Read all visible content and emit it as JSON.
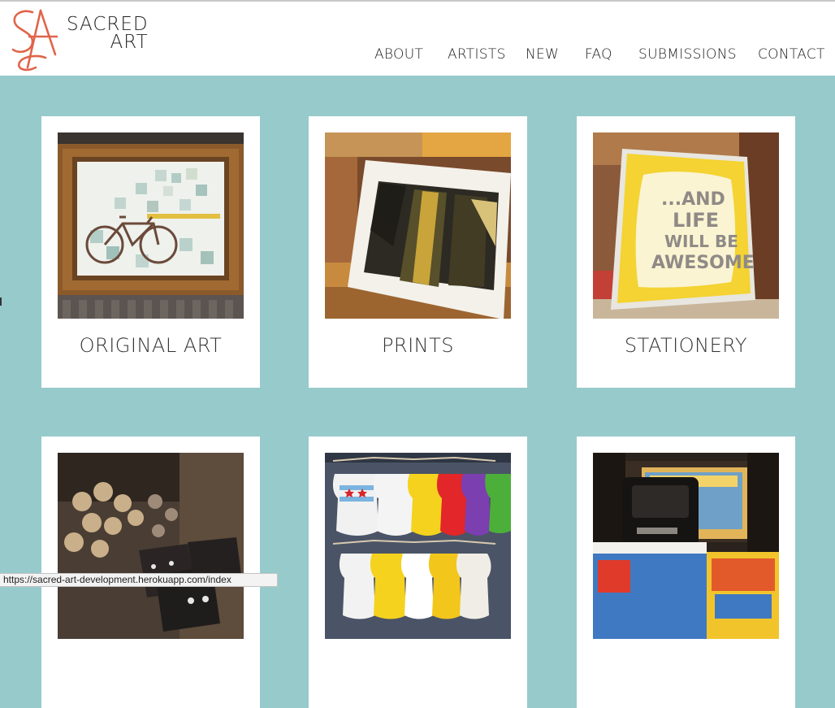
{
  "brand": {
    "monogram": "SA",
    "line1": "SACRED",
    "line2": "ART",
    "accent_color": "#e0644a"
  },
  "nav": [
    {
      "label": "ABOUT"
    },
    {
      "label": "ARTISTS"
    },
    {
      "label": "NEW"
    },
    {
      "label": "FAQ"
    },
    {
      "label": "SUBMISSIONS"
    },
    {
      "label": "CONTACT"
    }
  ],
  "cards": [
    {
      "label": "ORIGINAL ART",
      "image": "framed-bicycle-painting"
    },
    {
      "label": "PRINTS",
      "image": "city-building-print"
    },
    {
      "label": "STATIONERY",
      "image": "and-life-will-be-awesome-card",
      "image_text": [
        "...AND",
        "LIFE",
        "WILL BE",
        "AWESOME"
      ]
    },
    {
      "label": "",
      "image": "jewelry-earrings"
    },
    {
      "label": "",
      "image": "chicago-baby-onesies"
    },
    {
      "label": "",
      "image": "vintage-camera-and-books"
    }
  ],
  "status_url": "https://sacred-art-development.herokuapp.com/index",
  "colors": {
    "background": "#97cacb",
    "card": "#ffffff",
    "text": "#333333"
  }
}
